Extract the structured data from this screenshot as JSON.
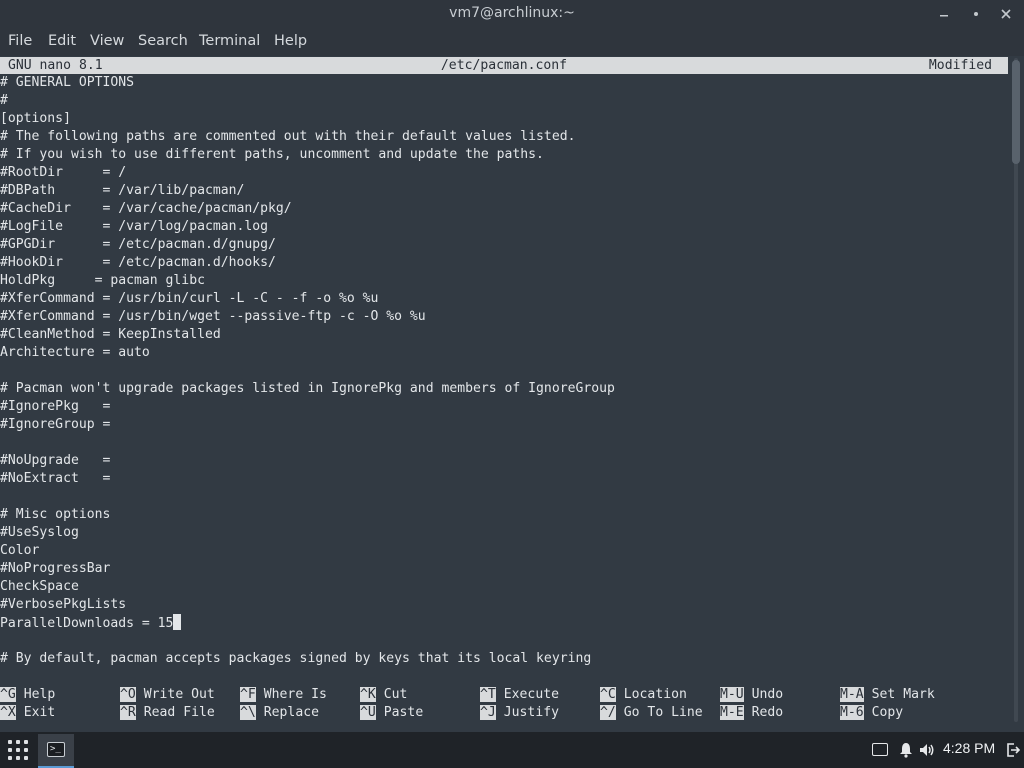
{
  "window": {
    "title": "vm7@archlinux:~"
  },
  "menu": [
    "File",
    "Edit",
    "View",
    "Search",
    "Terminal",
    "Help"
  ],
  "nano": {
    "version": "GNU nano 8.1",
    "filename": "/etc/pacman.conf",
    "status": "Modified"
  },
  "lines": [
    "# GENERAL OPTIONS",
    "#",
    "[options]",
    "# The following paths are commented out with their default values listed.",
    "# If you wish to use different paths, uncomment and update the paths.",
    "#RootDir     = /",
    "#DBPath      = /var/lib/pacman/",
    "#CacheDir    = /var/cache/pacman/pkg/",
    "#LogFile     = /var/log/pacman.log",
    "#GPGDir      = /etc/pacman.d/gnupg/",
    "#HookDir     = /etc/pacman.d/hooks/",
    "HoldPkg     = pacman glibc",
    "#XferCommand = /usr/bin/curl -L -C - -f -o %o %u",
    "#XferCommand = /usr/bin/wget --passive-ftp -c -O %o %u",
    "#CleanMethod = KeepInstalled",
    "Architecture = auto",
    "",
    "# Pacman won't upgrade packages listed in IgnorePkg and members of IgnoreGroup",
    "#IgnorePkg   =",
    "#IgnoreGroup =",
    "",
    "#NoUpgrade   =",
    "#NoExtract   =",
    "",
    "# Misc options",
    "#UseSyslog",
    "Color",
    "#NoProgressBar",
    "CheckSpace",
    "#VerbosePkgLists",
    "ParallelDownloads = 15",
    "",
    "# By default, pacman accepts packages signed by keys that its local keyring"
  ],
  "shortcuts": [
    {
      "key": "^G",
      "label": "Help"
    },
    {
      "key": "^O",
      "label": "Write Out"
    },
    {
      "key": "^F",
      "label": "Where Is"
    },
    {
      "key": "^K",
      "label": "Cut"
    },
    {
      "key": "^T",
      "label": "Execute"
    },
    {
      "key": "^C",
      "label": "Location"
    },
    {
      "key": "M-U",
      "label": "Undo"
    },
    {
      "key": "M-A",
      "label": "Set Mark"
    },
    {
      "key": "^X",
      "label": "Exit"
    },
    {
      "key": "^R",
      "label": "Read File"
    },
    {
      "key": "^\\",
      "label": "Replace"
    },
    {
      "key": "^U",
      "label": "Paste"
    },
    {
      "key": "^J",
      "label": "Justify"
    },
    {
      "key": "^/",
      "label": "Go To Line"
    },
    {
      "key": "M-E",
      "label": "Redo"
    },
    {
      "key": "M-6",
      "label": "Copy"
    }
  ],
  "taskbar": {
    "clock": "4:28 PM"
  },
  "icons": {
    "minimize": "minimize-icon",
    "restore": "restore-icon",
    "close": "close-icon",
    "apps": "app-grid-icon",
    "terminal": "terminal-icon",
    "keyboard": "keyboard-icon",
    "bell": "bell-icon",
    "volume": "volume-icon",
    "logout": "logout-icon"
  },
  "colors": {
    "terminal_bg": "#323a43",
    "chrome_bg": "#2f353d",
    "inverse_bg": "#d8dadc",
    "taskbar_bg": "#1f2328"
  }
}
